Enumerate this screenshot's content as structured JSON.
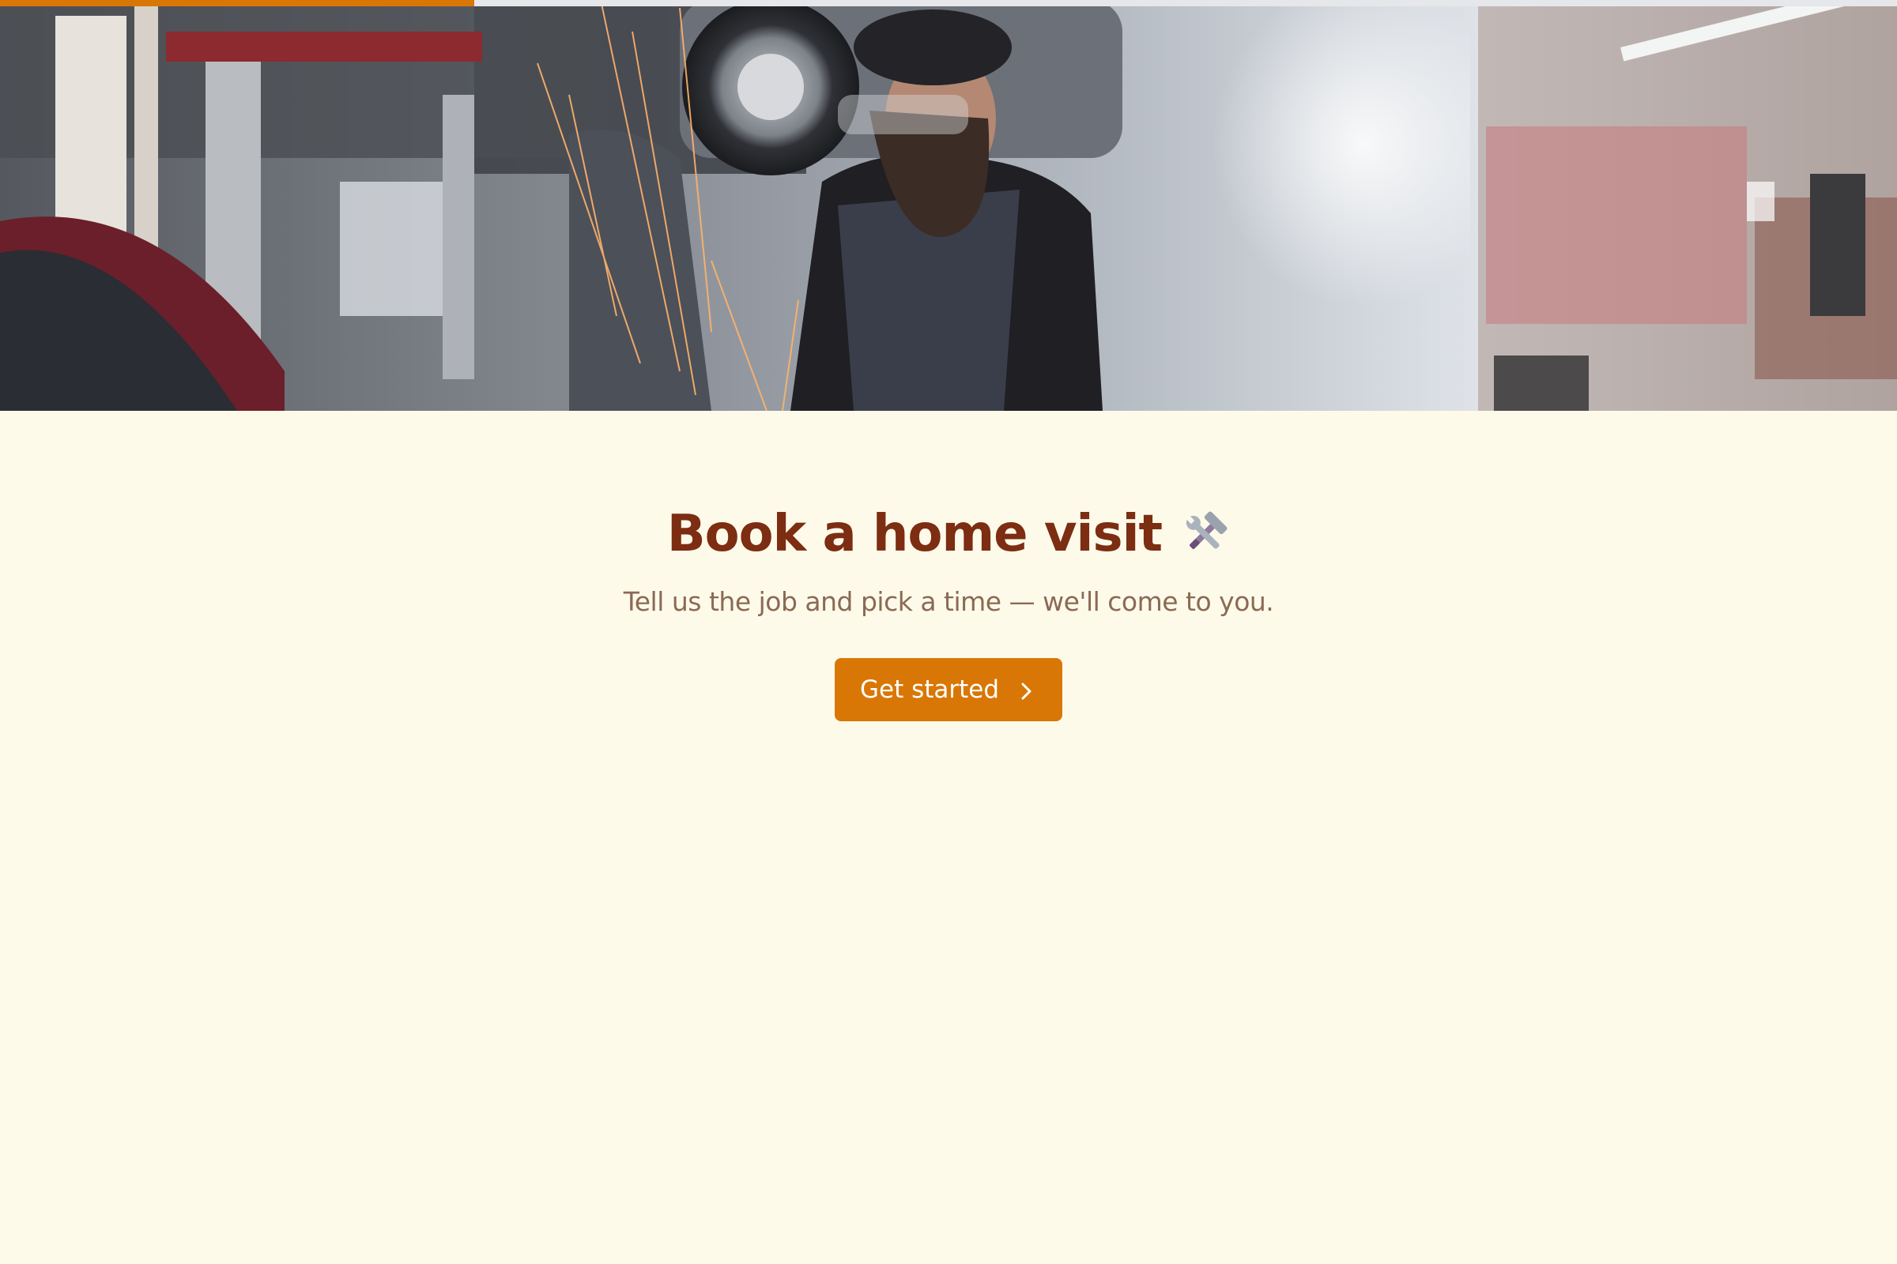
{
  "progress": {
    "value": 0.25,
    "fill_color": "#d97706",
    "track_color": "#e6e7ea"
  },
  "hero": {
    "icon": "garage-mechanic-photo"
  },
  "booking": {
    "title": "Book a home visit",
    "title_icon": "hammer-and-wrench-icon",
    "subtitle": "Tell us the job and pick a time — we'll come to you.",
    "cta_label": "Get started",
    "cta_icon": "chevron-right-icon"
  },
  "colors": {
    "background": "#fefae9",
    "title": "#7c2d12",
    "subtitle": "#8a6a55",
    "accent": "#d97706"
  }
}
